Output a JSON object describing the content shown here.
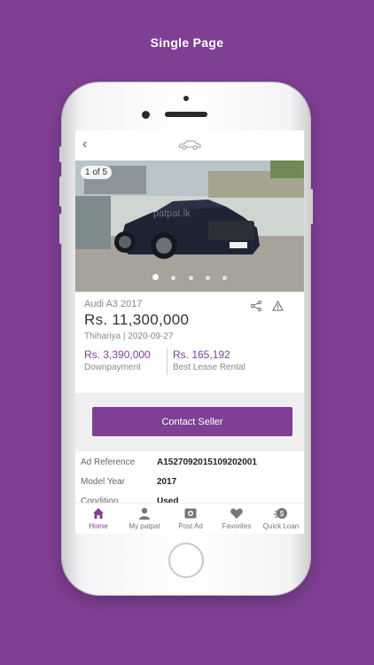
{
  "caption": "Single Page",
  "listing": {
    "image_counter": "1 of 5",
    "watermark": "patpat.lk",
    "model": "Audi A3 2017",
    "price": "Rs. 11,300,000",
    "location_date": "Thihariya |  2020-09-27",
    "downpayment_value": "Rs. 3,390,000",
    "downpayment_label": "Downpayment",
    "lease_value": "Rs. 165,192",
    "lease_label": "Best Lease Rental",
    "contact_label": "Contact Seller"
  },
  "details": [
    {
      "label": "Ad Reference",
      "value": "A1527092015109202001"
    },
    {
      "label": "Model Year",
      "value": "2017"
    },
    {
      "label": "Condition",
      "value": "Used"
    }
  ],
  "nav": {
    "home": "Home",
    "my_patpat": "My patpat",
    "post_ad": "Post Ad",
    "favorites": "Favorites",
    "quick_loan": "Quick Loan"
  },
  "colors": {
    "accent": "#7f3f93",
    "background": "#7f3f93"
  }
}
